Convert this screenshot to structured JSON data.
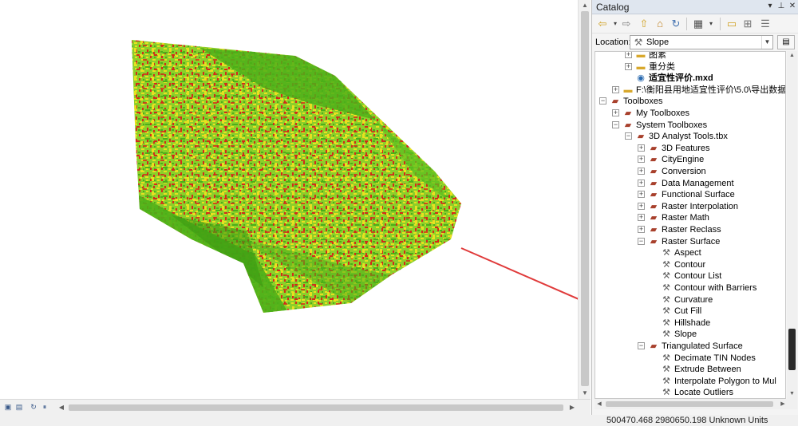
{
  "map": {
    "colors": {
      "green": "#4caf1a",
      "light_green": "#8ccf2a",
      "yellow": "#e8e020",
      "red": "#d42a1a",
      "arrow": "#e03a3a"
    }
  },
  "statusbar": {
    "coordinates": "500470.468  2980650.198 Unknown Units"
  },
  "catalog": {
    "title": "Catalog",
    "location_label": "Location:",
    "location_value": "Slope",
    "toolbar_icons": [
      "back-icon",
      "dropdown-icon",
      "forward-icon",
      "up-icon",
      "home-icon",
      "refresh-icon",
      "view-icon",
      "connect-folder-icon",
      "disconnect-icon",
      "options-icon"
    ],
    "tree": [
      {
        "label": "图素",
        "indent": 2,
        "icon": "folder-icon",
        "expander": "+"
      },
      {
        "label": "重分类",
        "indent": 2,
        "icon": "folder-icon",
        "expander": "+"
      },
      {
        "label": "适宜性评价.mxd",
        "indent": 2,
        "icon": "mxd-icon",
        "expander": "",
        "bold": true
      },
      {
        "label": "F:\\衡阳县用地适宜性评价\\5.0\\导出数据",
        "indent": 1,
        "icon": "folder-icon",
        "expander": "+"
      },
      {
        "label": "Toolboxes",
        "indent": 0,
        "icon": "toolbox-icon",
        "expander": "-"
      },
      {
        "label": "My Toolboxes",
        "indent": 1,
        "icon": "toolbox-icon",
        "expander": "+"
      },
      {
        "label": "System Toolboxes",
        "indent": 1,
        "icon": "toolbox-icon",
        "expander": "-"
      },
      {
        "label": "3D Analyst Tools.tbx",
        "indent": 2,
        "icon": "toolbox-icon",
        "expander": "-"
      },
      {
        "label": "3D Features",
        "indent": 3,
        "icon": "toolset-icon",
        "expander": "+"
      },
      {
        "label": "CityEngine",
        "indent": 3,
        "icon": "toolset-icon",
        "expander": "+"
      },
      {
        "label": "Conversion",
        "indent": 3,
        "icon": "toolset-icon",
        "expander": "+"
      },
      {
        "label": "Data Management",
        "indent": 3,
        "icon": "toolset-icon",
        "expander": "+"
      },
      {
        "label": "Functional Surface",
        "indent": 3,
        "icon": "toolset-icon",
        "expander": "+"
      },
      {
        "label": "Raster Interpolation",
        "indent": 3,
        "icon": "toolset-icon",
        "expander": "+"
      },
      {
        "label": "Raster Math",
        "indent": 3,
        "icon": "toolset-icon",
        "expander": "+"
      },
      {
        "label": "Raster Reclass",
        "indent": 3,
        "icon": "toolset-icon",
        "expander": "+"
      },
      {
        "label": "Raster Surface",
        "indent": 3,
        "icon": "toolset-icon",
        "expander": "-"
      },
      {
        "label": "Aspect",
        "indent": 4,
        "icon": "hammer-icon",
        "expander": ""
      },
      {
        "label": "Contour",
        "indent": 4,
        "icon": "hammer-icon",
        "expander": ""
      },
      {
        "label": "Contour List",
        "indent": 4,
        "icon": "hammer-icon",
        "expander": ""
      },
      {
        "label": "Contour with Barriers",
        "indent": 4,
        "icon": "hammer-icon",
        "expander": ""
      },
      {
        "label": "Curvature",
        "indent": 4,
        "icon": "hammer-icon",
        "expander": ""
      },
      {
        "label": "Cut Fill",
        "indent": 4,
        "icon": "hammer-icon",
        "expander": ""
      },
      {
        "label": "Hillshade",
        "indent": 4,
        "icon": "hammer-icon",
        "expander": ""
      },
      {
        "label": "Slope",
        "indent": 4,
        "icon": "hammer-icon",
        "expander": ""
      },
      {
        "label": "Triangulated Surface",
        "indent": 3,
        "icon": "toolset-icon",
        "expander": "-"
      },
      {
        "label": "Decimate TIN Nodes",
        "indent": 4,
        "icon": "hammer-icon",
        "expander": ""
      },
      {
        "label": "Extrude Between",
        "indent": 4,
        "icon": "hammer-icon",
        "expander": ""
      },
      {
        "label": "Interpolate Polygon to Mul",
        "indent": 4,
        "icon": "hammer-icon",
        "expander": ""
      },
      {
        "label": "Locate Outliers",
        "indent": 4,
        "icon": "hammer-icon",
        "expander": ""
      }
    ]
  }
}
